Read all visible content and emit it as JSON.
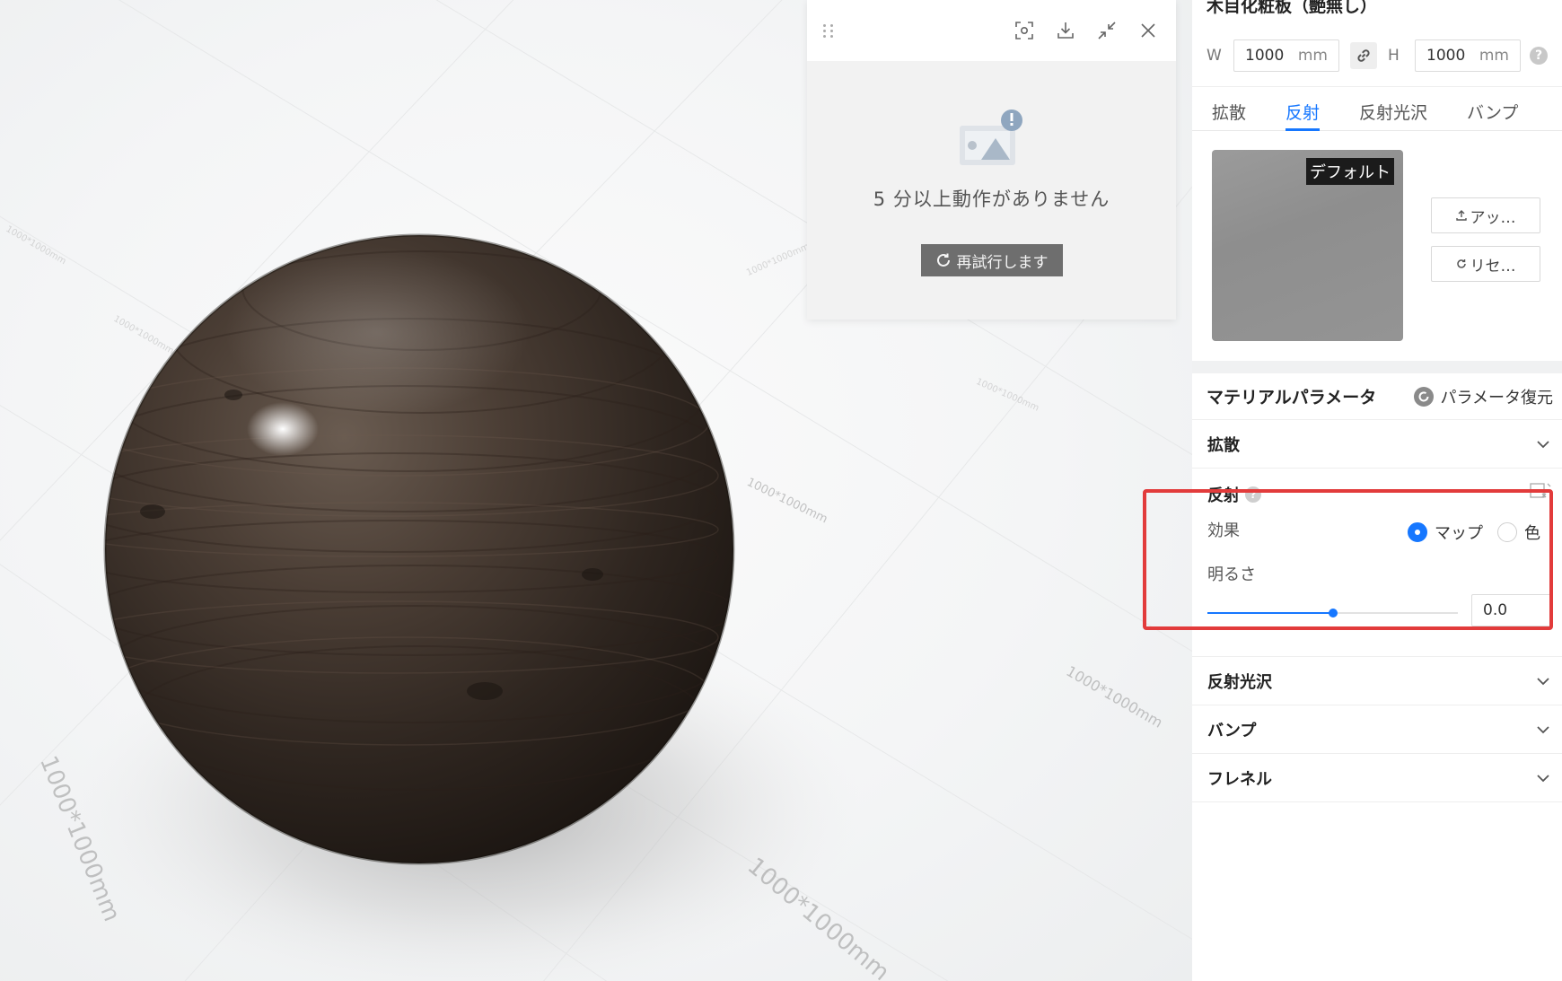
{
  "viewport": {
    "floor_labels": [
      "1000*1000mm",
      "1000*1000mm",
      "1000*1000mm",
      "1000*1000mm",
      "1000*1000mm",
      "1000*1000mm",
      "1000*1000mm",
      "1000*1000mm"
    ]
  },
  "idle_dialog": {
    "message": "5 分以上動作がありません",
    "retry_label": "再試行します",
    "toolbar_icons": [
      "drag-handle-icon",
      "screenshot-icon",
      "download-icon",
      "collapse-icon",
      "close-icon"
    ]
  },
  "material": {
    "title": "木目化粧板（艶無し）",
    "width_label": "W",
    "width_value": "1000",
    "height_label": "H",
    "height_value": "1000",
    "unit": "mm",
    "tabs": [
      "拡散",
      "反射",
      "反射光沢",
      "バンプ"
    ],
    "active_tab": "反射",
    "thumbnail_badge": "デフォルト",
    "upload_label": "アッ…",
    "reset_label": "リセ…"
  },
  "params": {
    "title": "マテリアルパラメータ",
    "restore_label": "パラメータ復元",
    "sections": {
      "diffuse": "拡散",
      "reflection": "反射",
      "reflection_gloss": "反射光沢",
      "bump": "バンプ",
      "fresnel": "フレネル"
    },
    "reflection": {
      "effect_label": "効果",
      "options": [
        "マップ",
        "色"
      ],
      "selected_option": "マップ",
      "brightness_label": "明るさ",
      "brightness_value": "0.0",
      "slider_fraction": 0.5
    }
  },
  "colors": {
    "accent": "#1677ff",
    "highlight_box": "#e23b3b",
    "retry_button": "#6e6e6e"
  }
}
